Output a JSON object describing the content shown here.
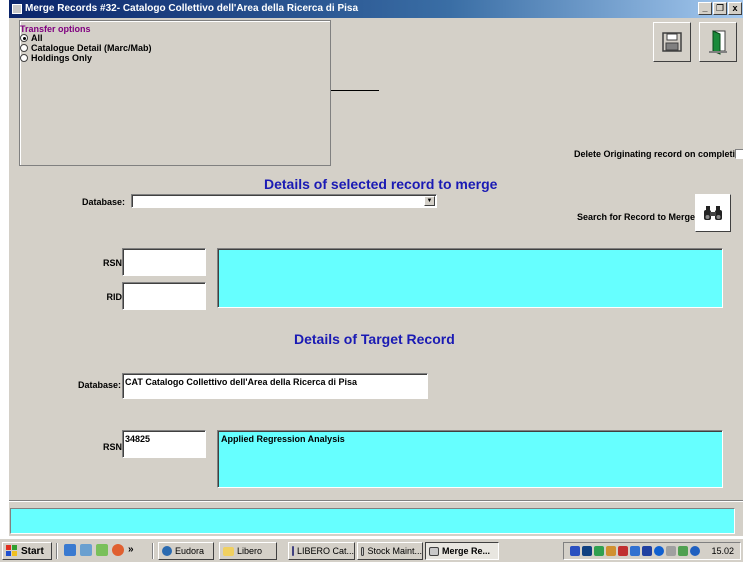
{
  "window": {
    "title": "Merge Records  #32- Catalogo Collettivo dell'Area della Ricerca di Pisa",
    "minimize": "_",
    "restore": "❐",
    "close": "x"
  },
  "transfer": {
    "legend": "Transfer options",
    "options": [
      {
        "label": "All",
        "checked": true
      },
      {
        "label": "Catalogue Detail (Marc/Mab)",
        "checked": false
      },
      {
        "label": "Holdings Only",
        "checked": false
      }
    ]
  },
  "toolbar": {
    "save_icon": "floppy-disk-icon",
    "exit_icon": "exit-door-icon"
  },
  "delete_option": {
    "label": "Delete Originating record on completion",
    "checked": false
  },
  "source": {
    "heading": "Details of selected record to merge",
    "database_label": "Database:",
    "database_value": "",
    "search_label": "Search for Record to Merge",
    "search_icon": "binoculars-icon",
    "rsn_label": "RSN:",
    "rsn_value": "",
    "rid_label": "RID:",
    "rid_value": "",
    "details": ""
  },
  "target": {
    "heading": "Details of Target Record",
    "database_label": "Database:",
    "database_value": "CAT Catalogo Collettivo dell'Area della Ricerca di Pisa",
    "rsn_label": "RSN:",
    "rsn_value": "34825",
    "details": "Applied Regression Analysis"
  },
  "status": "",
  "taskbar": {
    "start": "Start",
    "chevron": "»",
    "tasks": [
      {
        "label": "Eudora",
        "active": false
      },
      {
        "label": "Libero",
        "active": false
      },
      {
        "label": "LIBERO Cat...",
        "active": false
      },
      {
        "label": "Stock Maint...",
        "active": false
      },
      {
        "label": "Merge Re...",
        "active": true
      }
    ],
    "clock": "15.02"
  },
  "colors": {
    "heading": "#1a1ab4",
    "legend": "#800080",
    "cyan": "#66ffff",
    "face": "#d4d0c8"
  }
}
